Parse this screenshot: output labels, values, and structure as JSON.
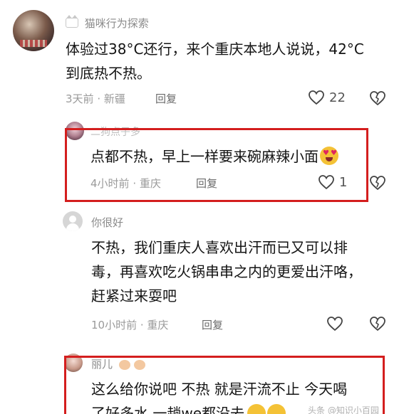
{
  "comments": [
    {
      "username": "猫咪行为探索",
      "badge_icon": "cat-icon",
      "text_line1": "体验过38°C还行，来个重庆本地人说说，42°C",
      "text_line2": "到底热不热。",
      "time": "3天前",
      "location": "新疆",
      "reply_label": "回复",
      "like_count": "22"
    }
  ],
  "replies": [
    {
      "username": "二狗点子多",
      "text": "点都不热，早上一样要来碗麻辣小面",
      "emoji": "heart-eyes-emoji",
      "time": "4小时前",
      "location": "重庆",
      "reply_label": "回复",
      "like_count": "1"
    },
    {
      "username": "你很好",
      "text_line1": "不热，我们重庆人喜欢出汗而已又可以排",
      "text_line2": "毒，再喜欢吃火锅串串之内的更爱出汗咯，",
      "text_line3": "赶紧过来耍吧",
      "time": "10小时前",
      "location": "重庆",
      "reply_label": "回复"
    },
    {
      "username": "丽儿",
      "text_line1": "这么给你说吧  不热  就是汗流不止  今天喝",
      "text_line2": "了好多水  一趟we都没去",
      "watermark": "头条 @知识小百园"
    }
  ],
  "separator": " · ",
  "colors": {
    "highlight_border": "#d41e1e",
    "meta": "#9a9a9a",
    "text": "#141414"
  }
}
